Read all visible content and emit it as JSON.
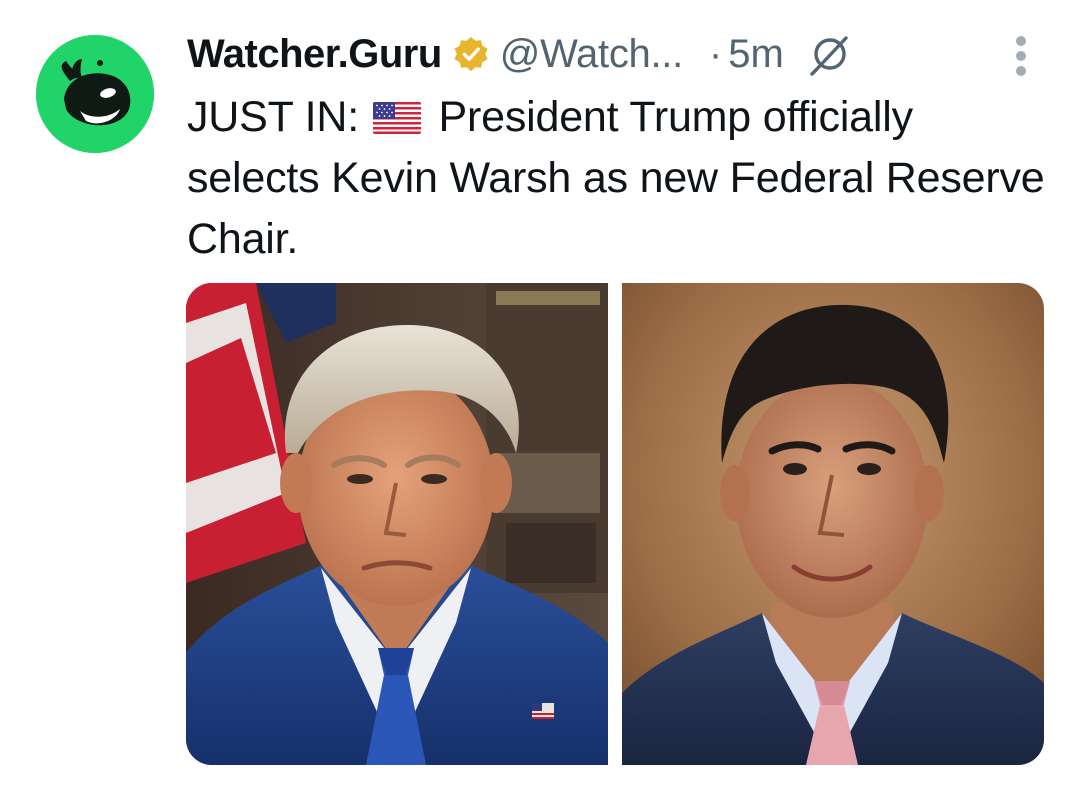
{
  "tweet": {
    "display_name": "Watcher.Guru",
    "handle": "@Watch...",
    "separator": "·",
    "time": "5m",
    "text_prefix": "JUST IN:",
    "text_body": "President Trump officially selects Kevin Warsh as new Federal Reserve Chair.",
    "avatar_color": "#21d46a",
    "verified_color": "#e8b62e",
    "icons": {
      "avatar": "whale-logo-icon",
      "verified": "verified-badge-icon",
      "grok": "grok-icon",
      "more": "more-options-icon",
      "flag": "us-flag-icon"
    },
    "media": [
      {
        "id": "photo-1",
        "subject": "portrait"
      },
      {
        "id": "photo-2",
        "subject": "portrait"
      }
    ]
  }
}
